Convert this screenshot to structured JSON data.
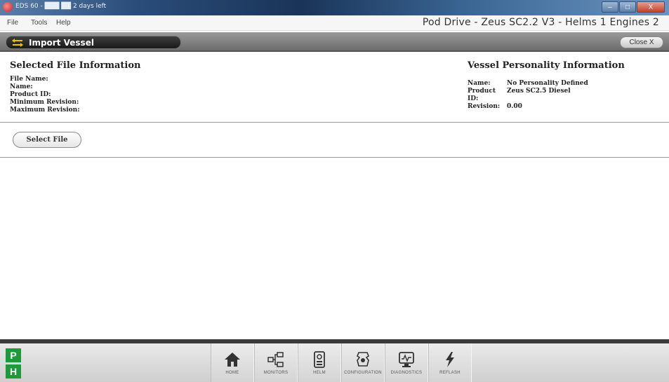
{
  "window": {
    "title": "EDS 60 - ███ ██ 2 days left",
    "controls": {
      "minimize": "–",
      "maximize": "□",
      "close": "X"
    }
  },
  "menu": {
    "items": [
      "File",
      "Tools",
      "Help"
    ],
    "status": "Pod Drive - Zeus SC2.2 V3 - Helms 1 Engines 2"
  },
  "header": {
    "title": "Import Vessel",
    "close_label": "Close X"
  },
  "selected_file": {
    "heading": "Selected File Information",
    "fields": [
      {
        "label": "File Name:",
        "value": ""
      },
      {
        "label": "Name:",
        "value": ""
      },
      {
        "label": "Product ID:",
        "value": ""
      },
      {
        "label": "Minimum Revision:",
        "value": ""
      },
      {
        "label": "Maximum Revision:",
        "value": ""
      }
    ]
  },
  "vessel_personality": {
    "heading": "Vessel Personality Information",
    "fields": [
      {
        "label": "Name:",
        "value": "No Personality Defined"
      },
      {
        "label": "Product ID:",
        "value": "Zeus SC2.5 Diesel"
      },
      {
        "label": "Revision:",
        "value": "0.00"
      }
    ]
  },
  "select_file_label": "Select File",
  "mode_indicators": [
    "P",
    "H"
  ],
  "nav": [
    {
      "label": "HOME",
      "icon": "home-icon"
    },
    {
      "label": "MONITORS",
      "icon": "monitors-icon"
    },
    {
      "label": "HELM",
      "icon": "helm-icon"
    },
    {
      "label": "CONFIGURATION",
      "icon": "configuration-icon"
    },
    {
      "label": "DIAGNOSTICS",
      "icon": "diagnostics-icon"
    },
    {
      "label": "REFLASH",
      "icon": "reflash-icon"
    }
  ],
  "colors": {
    "mode_indicator": "#1f9a3a",
    "title_pill": "#1a1a1a",
    "title_icon": "#f2c200"
  }
}
